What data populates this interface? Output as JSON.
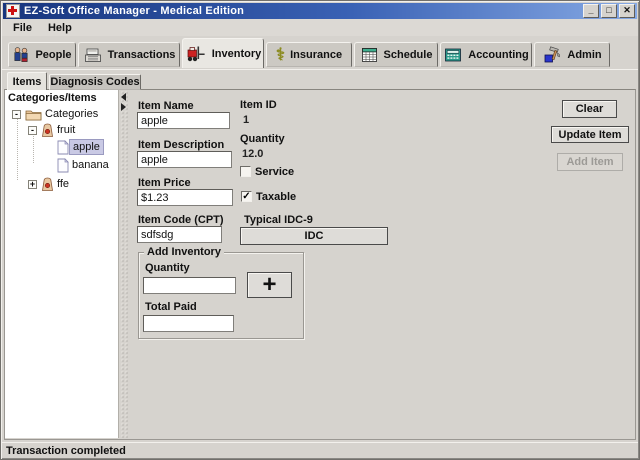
{
  "window": {
    "title": "EZ-Soft Office Manager  -  Medical Edition",
    "controls": {
      "minimize": "_",
      "maximize": "□",
      "close": "✕"
    }
  },
  "menu": {
    "file": "File",
    "help": "Help"
  },
  "tabs": [
    {
      "label": "People"
    },
    {
      "label": "Transactions"
    },
    {
      "label": "Inventory"
    },
    {
      "label": "Insurance"
    },
    {
      "label": "Schedule"
    },
    {
      "label": "Accounting"
    },
    {
      "label": "Admin"
    }
  ],
  "subtabs": [
    {
      "label": "Items"
    },
    {
      "label": "Diagnosis Codes"
    }
  ],
  "tree": {
    "header": "Categories/Items",
    "nodes": [
      {
        "label": "Categories",
        "icon": "folder",
        "expand": "-"
      },
      {
        "label": "fruit",
        "icon": "category",
        "expand": "-"
      },
      {
        "label": "apple",
        "icon": "item",
        "selected": true
      },
      {
        "label": "banana",
        "icon": "item"
      },
      {
        "label": "ffe",
        "icon": "category",
        "expand": "+"
      }
    ]
  },
  "form": {
    "item_name": {
      "label": "Item Name",
      "value": "apple"
    },
    "item_description": {
      "label": "Item Description",
      "value": "apple"
    },
    "item_price": {
      "label": "Item Price",
      "value": "$1.23"
    },
    "item_code": {
      "label": "Item Code (CPT)",
      "value": "sdfsdg"
    },
    "item_id": {
      "label": "Item ID",
      "value": "1"
    },
    "quantity": {
      "label": "Quantity",
      "value": "12.0"
    },
    "service": {
      "label": "Service",
      "checked": false,
      "glyph": ""
    },
    "taxable": {
      "label": "Taxable",
      "checked": true,
      "glyph": "✓"
    },
    "typical_idc": {
      "label": "Typical IDC-9",
      "button_label": "IDC"
    },
    "add_inventory": {
      "title": "Add Inventory",
      "quantity_label": "Quantity",
      "quantity_value": "",
      "total_paid_label": "Total Paid",
      "total_paid_value": "",
      "plus_label": "+"
    }
  },
  "actions": {
    "clear": "Clear",
    "update": "Update Item",
    "add": "Add Item"
  },
  "status": "Transaction completed",
  "colors": {
    "titlebar_left": "#17357e",
    "titlebar_right": "#86a9e4",
    "panel": "#d6d3ce",
    "selection": "#c9c9e4",
    "forklift_red": "#cc2222",
    "calculator_teal": "#2a9a8a"
  }
}
